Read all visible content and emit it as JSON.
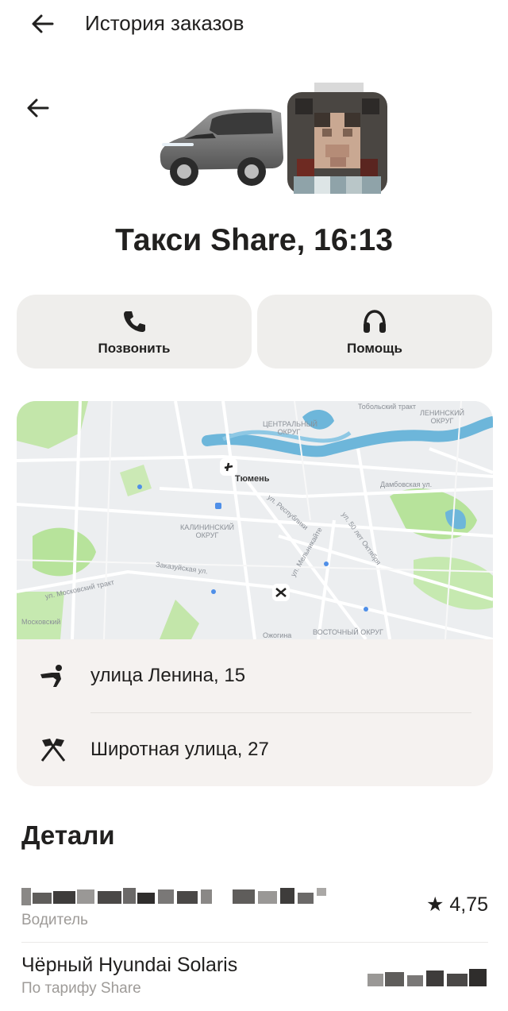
{
  "header": {
    "title": "История заказов"
  },
  "order": {
    "title": "Такси Share, 16:13"
  },
  "actions": {
    "call_label": "Позвонить",
    "help_label": "Помощь"
  },
  "map": {
    "city": "Тюмень",
    "labels": {
      "central_district": "ЦЕНТРАЛЬНЫЙ ОКРУГ",
      "kalinin_district": "КАЛИНИНСКИЙ ОКРУГ",
      "leninsky_district": "ЛЕНИНСКИЙ ОКРУГ",
      "vostochny_district": "ВОСТОЧНЫЙ ОКРУГ",
      "moskovsky": "Московский",
      "ozhogina": "Ожогина",
      "tobolsky_trakt": "Тобольский тракт",
      "moskovsky_trakt": "ул. Московский тракт",
      "zakaluzhskaya": "Заказуйская ул.",
      "respubliki": "ул. Республики",
      "melnikaite": "ул. Мельникайте",
      "50_let_oktyabrya": "ул. 50 лет Октября",
      "damba": "Дамбовская ул."
    }
  },
  "route": {
    "from": "улица Ленина, 15",
    "to": "Широтная улица, 27"
  },
  "details": {
    "title": "Детали",
    "driver_label": "Водитель",
    "rating": "★ 4,75",
    "car_name": "Чёрный Hyundai Solaris",
    "tariff": "По тарифу Share"
  },
  "colors": {
    "card_bg": "#efeeec",
    "route_bg": "#f5f2f0",
    "map_water": "#6db6da",
    "map_park": "#b7e39b",
    "map_land": "#eceef0",
    "muted_text": "#9e9b98"
  },
  "icons": {
    "back": "arrow-left-icon",
    "call": "phone-icon",
    "help": "headset-icon",
    "from": "walking-person-icon",
    "to": "finish-flags-icon"
  }
}
